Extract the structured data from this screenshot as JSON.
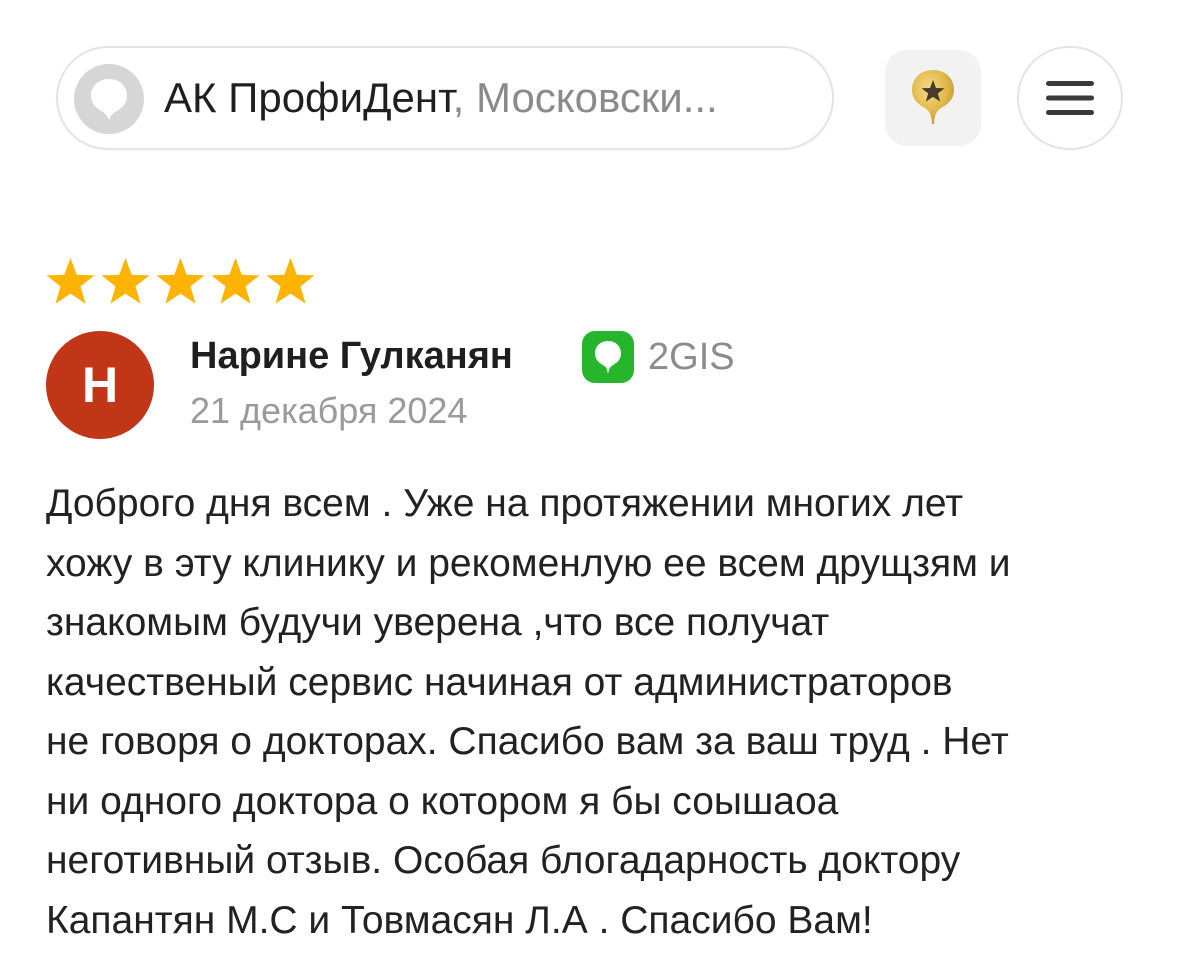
{
  "header": {
    "company_name": "АК ПрофиДент",
    "company_address": ", Московски...",
    "logo_icon": "2gis-logo-icon",
    "favorite_icon": "star-pin-icon",
    "menu_icon": "hamburger-menu-icon"
  },
  "review": {
    "rating": 5,
    "rating_max": 5,
    "author_initial": "Н",
    "author_name": "Нарине Гулканян",
    "source_name": "2GIS",
    "date": "21 декабря 2024",
    "lines": [
      "Доброго дня всем . Уже на протяжении многих лет",
      "хожу в эту клинику и рекоменлую ее всем друщзям и",
      "знакомым будучи уверена ,что все получат",
      "качественый сервис начиная от администраторов",
      "не говоря о докторах. Спасибо вам за ваш труд . Нет",
      "ни одного доктора о котором я бы соышаоа",
      "неготивный отзыв. Особая блогадарность доктору",
      "Капантян М.С и Товмасян Л.А . Спасибо Вам!"
    ]
  },
  "colors": {
    "star": "#fcb400",
    "avatar": "#c03616",
    "source_badge": "#27b52c",
    "pin_gold": "#e0b84a"
  }
}
